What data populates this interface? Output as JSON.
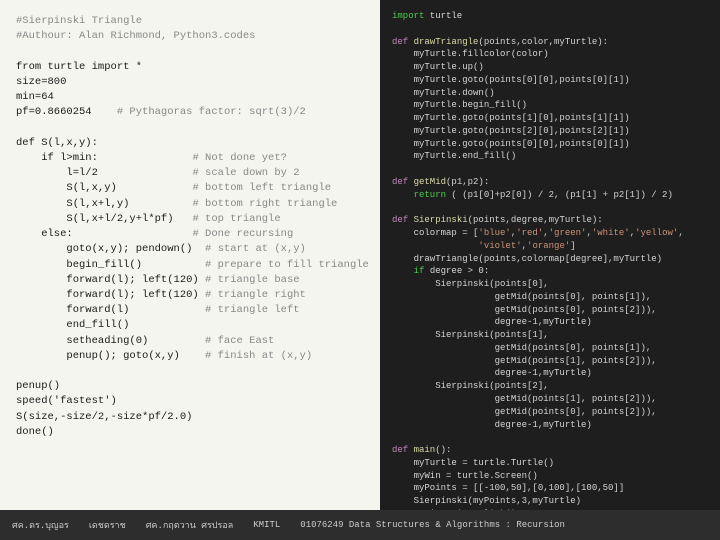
{
  "left": {
    "lines": [
      {
        "text": "#Sierpinski Triangle",
        "type": "comment"
      },
      {
        "text": "#Authour: Alan Richmond, Python3.codes",
        "type": "comment"
      },
      {
        "text": "",
        "type": "normal"
      },
      {
        "text": "from turtle import *",
        "type": "normal"
      },
      {
        "text": "size=800",
        "type": "normal"
      },
      {
        "text": "min=64",
        "type": "normal"
      },
      {
        "text": "pf=0.8660254    # Pythagorас factor: sqrt(3)/2",
        "type": "mixed"
      },
      {
        "text": "",
        "type": "normal"
      },
      {
        "text": "def S(l,x,y):",
        "type": "normal"
      },
      {
        "text": "    if l>min:                 # Not done yet?",
        "type": "mixed"
      },
      {
        "text": "        l=l/2                 # scale down by 2",
        "type": "mixed"
      },
      {
        "text": "        S(l,x,y)              # bottom left triangle",
        "type": "mixed"
      },
      {
        "text": "        S(l,x+l,y)            # bottom right triangle",
        "type": "mixed"
      },
      {
        "text": "        S(l,x+l/2,y+l*pf)     # top triangle",
        "type": "mixed"
      },
      {
        "text": "    else:                     # Done recursing",
        "type": "mixed"
      },
      {
        "text": "        goto(x,y); pendown()  # start at (x,y)",
        "type": "mixed"
      },
      {
        "text": "        begin_fill()          # prepare to fill triangle",
        "type": "mixed"
      },
      {
        "text": "        forward(l); left(120) # triangle base",
        "type": "mixed"
      },
      {
        "text": "        forward(l); left(120) # triangle right",
        "type": "mixed"
      },
      {
        "text": "        forward(l)            # triangle left",
        "type": "mixed"
      },
      {
        "text": "        end_fill()",
        "type": "normal"
      },
      {
        "text": "        setheading(0)         # face East",
        "type": "mixed"
      },
      {
        "text": "        penup(); goto(x,y)    # finish at (x,y)",
        "type": "mixed"
      },
      {
        "text": "",
        "type": "normal"
      },
      {
        "text": "penup()",
        "type": "normal"
      },
      {
        "text": "speed('fastest')",
        "type": "normal"
      },
      {
        "text": "S(size,-size/2,-size*pf/2.0)",
        "type": "normal"
      },
      {
        "text": "done()",
        "type": "normal"
      }
    ]
  },
  "right": {
    "raw": "import turtle\n\ndef drawTriangle(points,color,myTurtle):\n    myTurtle.fillcolor(color)\n    myTurtle.up()\n    myTurtle.goto(points[0][0],points[0][1])\n    myTurtle.down()\n    myTurtle.begin_fill()\n    myTurtle.goto(points[1][0],points[1][1])\n    myTurtle.goto(points[2][0],points[2][1])\n    myTurtle.goto(points[0][0],points[0][1])\n    myTurtle.end_fill()\n\ndef getMid(p1,p2):\n    return ( (p1[0]+p2[0]) / 2, (p1[1] + p2[1]) / 2)\n\ndef Sierpinski(points,degree,myTurtle):\n    colormap = ['blue','red','green','white','yellow',\n                'violet','orange']\n    drawTriangle(points,colormap[degree],myTurtle)\n    if degree > 0:\n        Sierpinski(points[0],\n                   getMid(points[0], points[1]),\n                   getMid(points[0], points[2])),\n                   degree-1,myTurtle)\n        Sierpinski(points[1],\n                   getMid(points[0], points[1]),\n                   getMid(points[1], points[2])),\n                   degree-1,myTurtle)\n        Sierpinski(points[2],\n                   getMid(points[1], points[2])),\n                   getMid(points[0], points[2])),\n                   degree-1,myTurtle)\n\ndef main():\n    myTurtle = turtle.Turtle()\n    myWin = turtle.Screen()\n    myPoints = [[-100,50],[0,100],[100,50]]\n    Sierpinski(myPoints,3,myTurtle)\n    myWin.exitonclick()\nmain()"
  },
  "statusbar": {
    "items": [
      "ศค.ดร.บุญอร",
      "เดชดราช",
      "ศค.กฤตวาน  ศรปรอล",
      "KMITL",
      "01076249 Data Structures & Algorithms : Recursion"
    ]
  }
}
